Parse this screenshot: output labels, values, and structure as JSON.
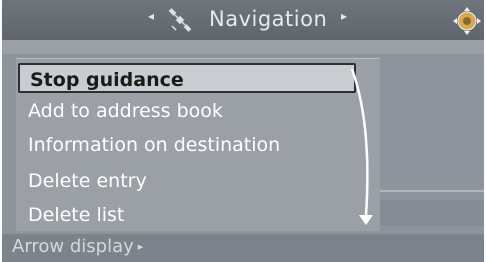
{
  "header": {
    "title": "Navigation",
    "left_arrow": "◂",
    "right_arrow": "▸",
    "icons": [
      "satellite-icon",
      "controller-icon"
    ]
  },
  "menu": {
    "items": [
      {
        "label": "Stop guidance",
        "selected": true
      },
      {
        "label": "Add to address book",
        "selected": false
      },
      {
        "label": "Information on destination",
        "selected": false
      },
      {
        "label": "Delete entry",
        "selected": false
      },
      {
        "label": "Delete list",
        "selected": false
      }
    ]
  },
  "status": {
    "label": "Arrow display",
    "arrow": "▸"
  },
  "colors": {
    "background": "#8e949b",
    "titlebar": "#666c73",
    "selection": "#c9cdd1",
    "text": "#ffffff"
  }
}
